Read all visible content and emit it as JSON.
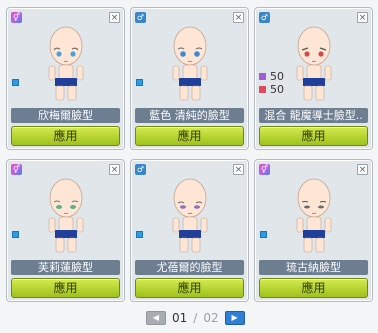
{
  "cards": [
    {
      "name": "欣梅爾臉型",
      "apply_label": "應用",
      "gender": "mixed",
      "gender_icon": "gender-mixed-icon",
      "eye_color": "#4aa3d8",
      "mix": null
    },
    {
      "name": "藍色 清純的臉型",
      "apply_label": "應用",
      "gender": "male",
      "gender_icon": "male-icon",
      "eye_color": "#3b8bd4",
      "mix": null
    },
    {
      "name": "混合 龍魔導士臉型..",
      "apply_label": "應用",
      "gender": "male",
      "gender_icon": "male-icon",
      "eye_color": "#d24a4a",
      "mix": [
        {
          "color": "#a45bd8",
          "value": "50"
        },
        {
          "color": "#e04a5a",
          "value": "50"
        }
      ]
    },
    {
      "name": "芙莉蓮臉型",
      "apply_label": "應用",
      "gender": "mixed",
      "gender_icon": "gender-mixed-icon",
      "eye_color": "#5fb08a",
      "mix": null
    },
    {
      "name": "尤蓓爾的臉型",
      "apply_label": "應用",
      "gender": "male",
      "gender_icon": "male-icon",
      "eye_color": "#8b6fc8",
      "mix": null
    },
    {
      "name": "琉古納臉型",
      "apply_label": "應用",
      "gender": "mixed",
      "gender_icon": "gender-mixed-icon",
      "eye_color": "#6c6c6c",
      "mix": null
    }
  ],
  "close_label": "×",
  "pager": {
    "current": "01",
    "separator": "/",
    "total": "02",
    "prev_icon": "◀",
    "next_icon": "▶"
  }
}
